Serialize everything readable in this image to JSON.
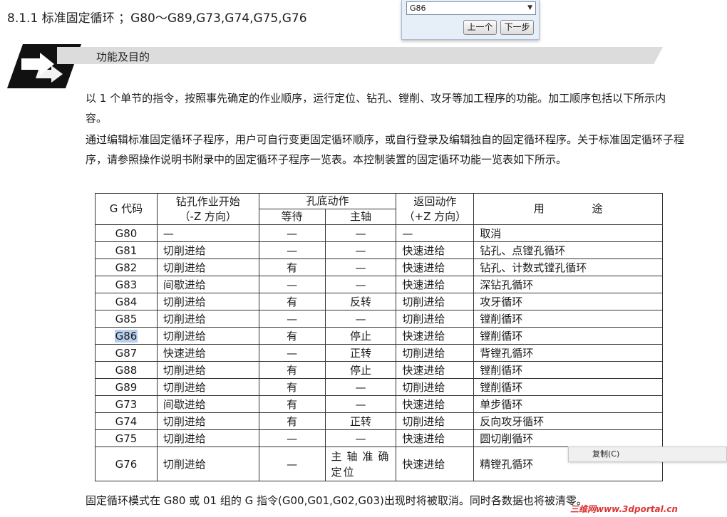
{
  "section_title": "8.1.1  标准固定循环 ；G80～G89,G73,G74,G75,G76",
  "find": {
    "value": "G86",
    "prev_label": "上一个",
    "next_label": "下一步"
  },
  "banner": {
    "label": "功能及目的"
  },
  "paragraphs": [
    "以 1 个单节的指令，按照事先确定的作业顺序，运行定位、钻孔、镗削、攻牙等加工程序的功能。加工顺序包括以下所示内容。",
    "通过编辑标准固定循环子程序，用户可自行变更固定循环顺序，或自行登录及编辑独自的固定循环程序。关于标准固定循环子程序，请参照操作说明书附录中的固定循环子程序一览表。本控制装置的固定循环功能一览表如下所示。"
  ],
  "table": {
    "headers": {
      "gcode": "G 代码",
      "drill_start_1": "钻孔作业开始",
      "drill_start_2": "（-Z 方向）",
      "hole_bottom": "孔底动作",
      "dwell": "等待",
      "spindle": "主轴",
      "return_1": "返回动作",
      "return_2": "（+Z 方向）",
      "usage": "用              途"
    },
    "rows": [
      {
        "code": "G80",
        "drill": "—",
        "dwell": "—",
        "spindle": "—",
        "ret": "—",
        "usage": "取消"
      },
      {
        "code": "G81",
        "drill": "切削进给",
        "dwell": "—",
        "spindle": "—",
        "ret": "快速进给",
        "usage": "钻孔、点镗孔循环"
      },
      {
        "code": "G82",
        "drill": "切削进给",
        "dwell": "有",
        "spindle": "—",
        "ret": "快速进给",
        "usage": "钻孔、计数式镗孔循环"
      },
      {
        "code": "G83",
        "drill": "间歇进给",
        "dwell": "—",
        "spindle": "—",
        "ret": "快速进给",
        "usage": "深钻孔循环"
      },
      {
        "code": "G84",
        "drill": "切削进给",
        "dwell": "有",
        "spindle": "反转",
        "ret": "切削进给",
        "usage": "攻牙循环"
      },
      {
        "code": "G85",
        "drill": "切削进给",
        "dwell": "—",
        "spindle": "—",
        "ret": "切削进给",
        "usage": "镗削循环"
      },
      {
        "code": "G86",
        "drill": "切削进给",
        "dwell": "有",
        "spindle": "停止",
        "ret": "快速进给",
        "usage": "镗削循环"
      },
      {
        "code": "G87",
        "drill": "快速进给",
        "dwell": "—",
        "spindle": "正转",
        "ret": "切削进给",
        "usage": "背镗孔循环"
      },
      {
        "code": "G88",
        "drill": "切削进给",
        "dwell": "有",
        "spindle": "停止",
        "ret": "快速进给",
        "usage": "镗削循环"
      },
      {
        "code": "G89",
        "drill": "切削进给",
        "dwell": "有",
        "spindle": "—",
        "ret": "切削进给",
        "usage": "镗削循环"
      },
      {
        "code": "G73",
        "drill": "间歇进给",
        "dwell": "有",
        "spindle": "—",
        "ret": "快速进给",
        "usage": "单步循环"
      },
      {
        "code": "G74",
        "drill": "切削进给",
        "dwell": "有",
        "spindle": "正转",
        "ret": "切削进给",
        "usage": "反向攻牙循环"
      },
      {
        "code": "G75",
        "drill": "切削进给",
        "dwell": "—",
        "spindle": "—",
        "ret": "快速进给",
        "usage": "圆切削循环"
      },
      {
        "code": "G76",
        "drill": "切削进给",
        "dwell": "—",
        "spindle": "主轴准确定位",
        "ret": "快速进给",
        "usage": "精镗孔循环"
      }
    ]
  },
  "footer": "固定循环模式在 G80 或 01 组的 G 指令(G00,G01,G02,G03)出现时将被取消。同时各数据也将被清零。",
  "context_menu": {
    "copy_label": "复制(C)"
  },
  "watermark": "三维网www.3dportal.cn"
}
